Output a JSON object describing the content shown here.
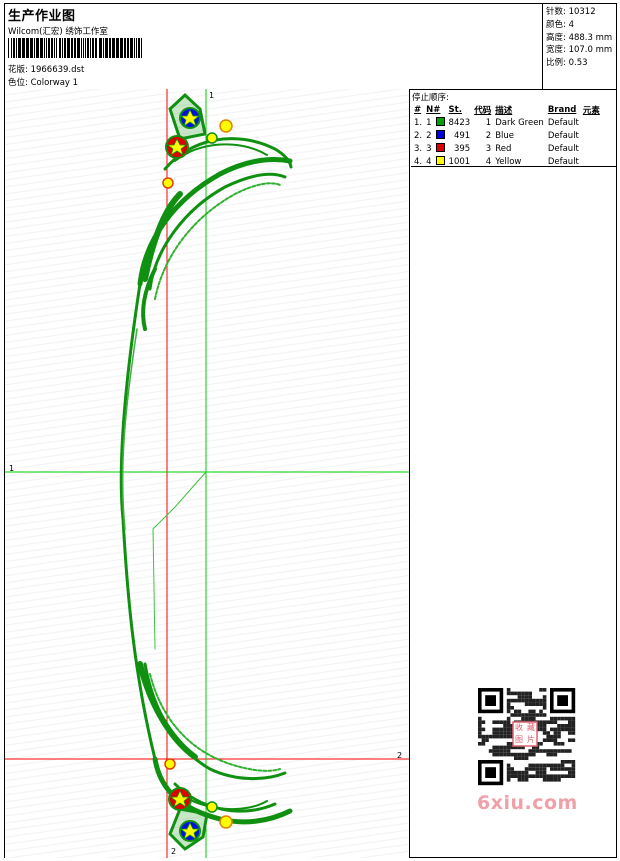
{
  "header": {
    "title": "生产作业图",
    "company": "Wilcom(汇宏) 绣饰工作室",
    "barcode_number": "",
    "design_file_label": "花版:",
    "design_file": "1966639.dst",
    "colorway_label": "色位:",
    "colorway": "Colorway 1"
  },
  "stats": {
    "stitches_label": "针数:",
    "stitches": "10312",
    "colors_label": "颜色:",
    "colors": "4",
    "height_label": "高度:",
    "height": "488.3 mm",
    "width_label": "宽度:",
    "width": "107.0 mm",
    "scale_label": "比例:",
    "scale": "0.53"
  },
  "stop_sequence": {
    "title": "停止顺序:",
    "headers": {
      "num": "#",
      "n": "N#",
      "stitches": "St.",
      "code": "代码",
      "desc": "描述",
      "brand": "Brand",
      "element": "元素"
    },
    "rows": [
      {
        "num": "1.",
        "n": "1",
        "color": "#00a000",
        "stitches": "8423",
        "code": "1",
        "desc": "Dark Green",
        "brand": "Default"
      },
      {
        "num": "2.",
        "n": "2",
        "color": "#0000e0",
        "stitches": "491",
        "code": "2",
        "desc": "Blue",
        "brand": "Default"
      },
      {
        "num": "3.",
        "n": "3",
        "color": "#e00000",
        "stitches": "395",
        "code": "3",
        "desc": "Red",
        "brand": "Default"
      },
      {
        "num": "4.",
        "n": "4",
        "color": "#ffff00",
        "stitches": "1001",
        "code": "4",
        "desc": "Yellow",
        "brand": "Default"
      }
    ]
  },
  "axes": {
    "v_top": "1",
    "h_left": "1",
    "h_right": "2",
    "v_bottom": "2"
  },
  "watermark": {
    "text": "6xiu.com",
    "stamp": "收藏图片"
  },
  "colors": {
    "green": "#109010",
    "green_light": "#40c040",
    "blue": "#0010e0",
    "red": "#e00000",
    "yellow": "#ffff00",
    "guide_red": "#ff0000",
    "guide_green": "#00cc00"
  }
}
